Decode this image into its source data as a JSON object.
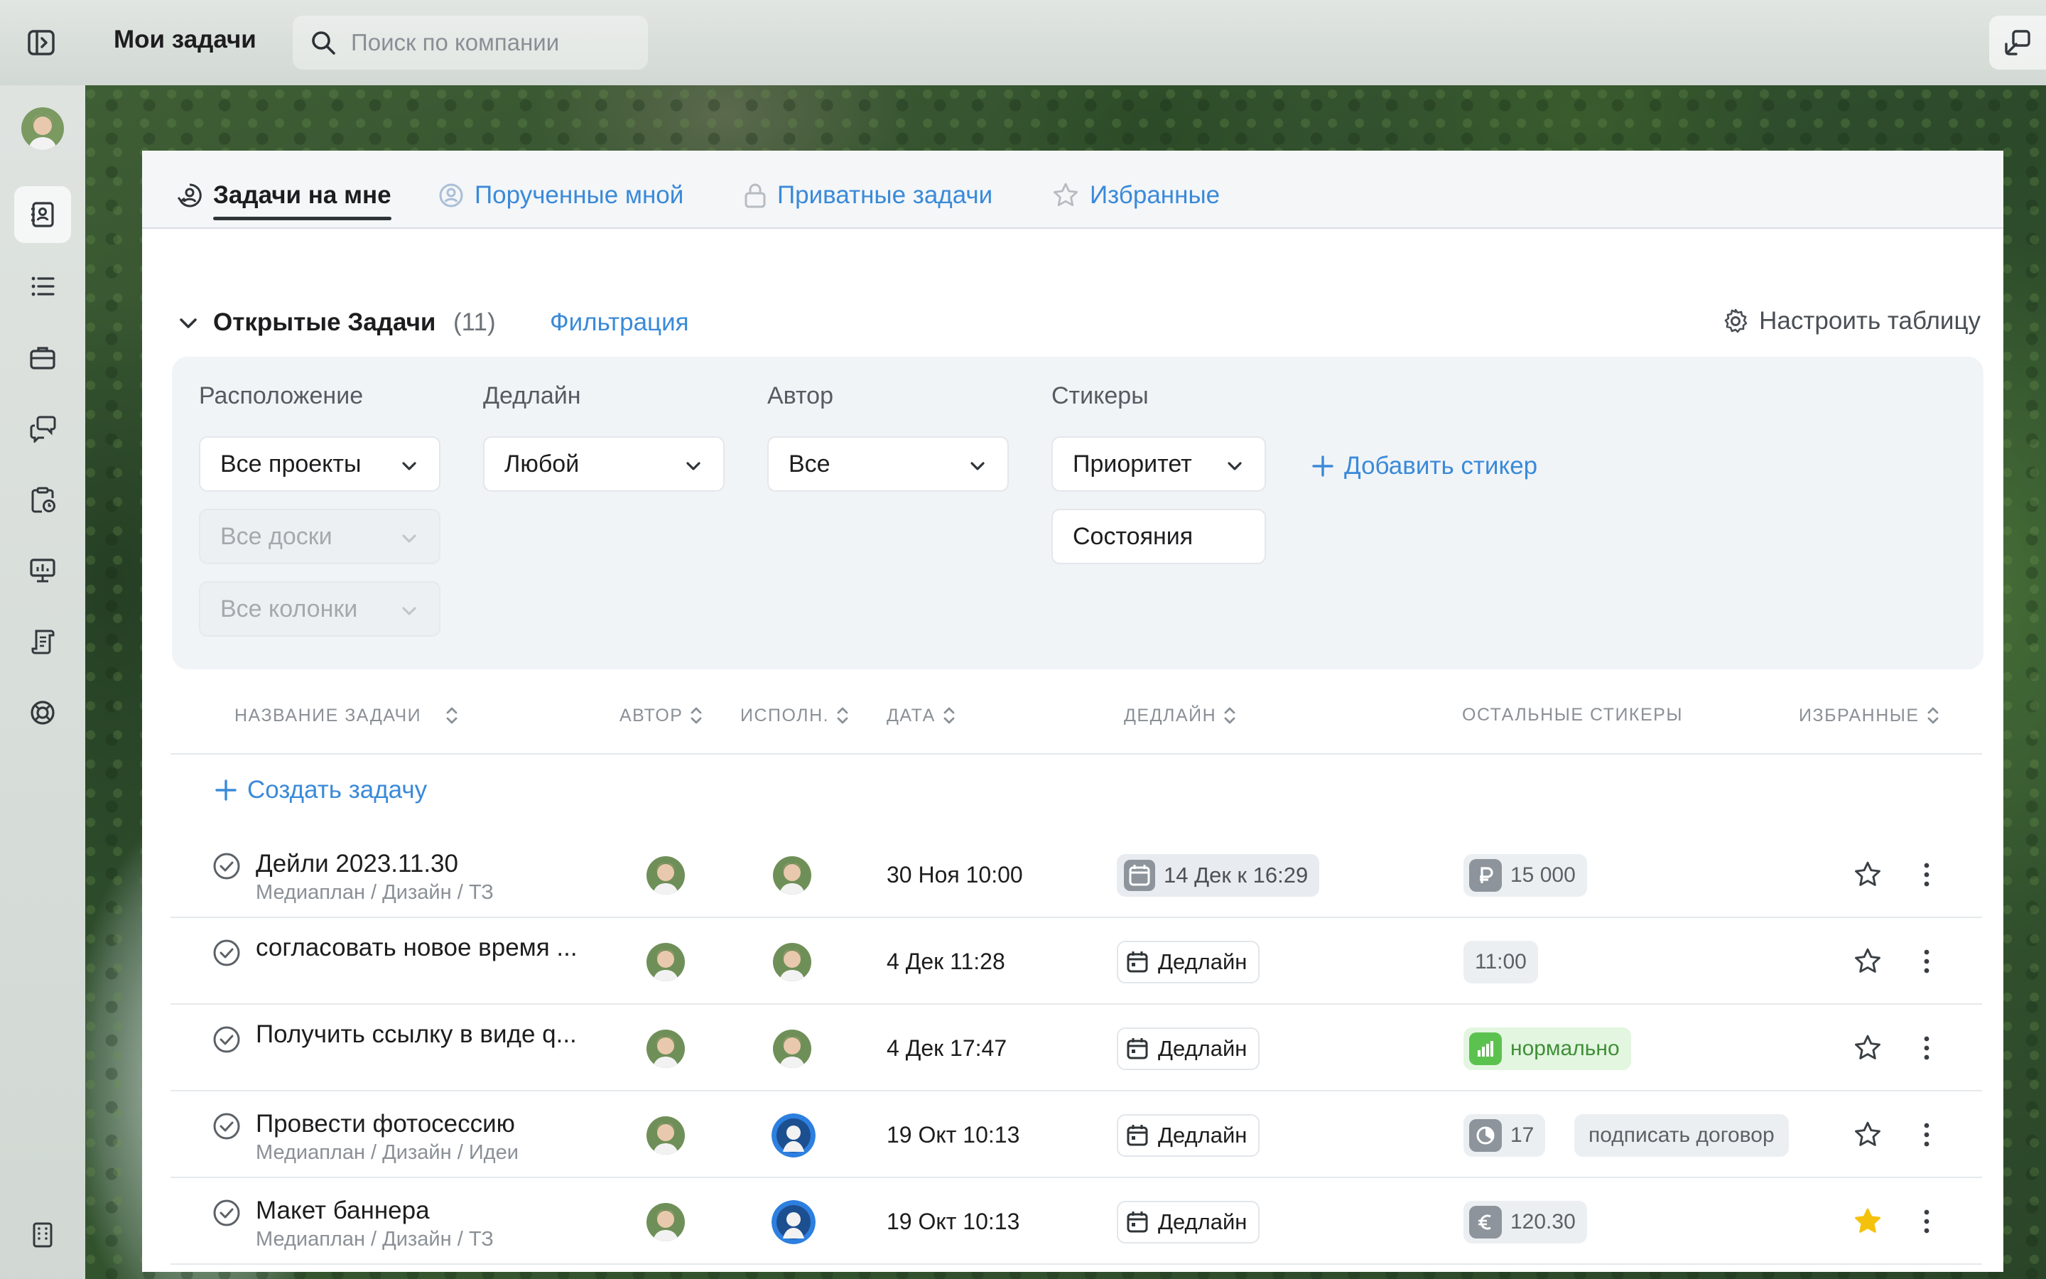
{
  "topbar": {
    "title": "Мои задачи",
    "search_placeholder": "Поиск по компании"
  },
  "tabs": [
    {
      "label": "Задачи на мне",
      "icon": "user-circle-icon",
      "active": true
    },
    {
      "label": "Порученные мной",
      "icon": "user-arrow-icon",
      "active": false
    },
    {
      "label": "Приватные задачи",
      "icon": "lock-icon",
      "active": false
    },
    {
      "label": "Избранные",
      "icon": "star-icon",
      "active": false
    }
  ],
  "section": {
    "title": "Открытые Задачи",
    "count": "(11)",
    "filter_label": "Фильтрация",
    "configure_label": "Настроить таблицу"
  },
  "filters": {
    "location_label": "Расположение",
    "location_projects": "Все проекты",
    "location_boards": "Все доски",
    "location_columns": "Все колонки",
    "deadline_label": "Дедлайн",
    "deadline_value": "Любой",
    "author_label": "Автор",
    "author_value": "Все",
    "stickers_label": "Стикеры",
    "sticker_priority": "Приоритет",
    "sticker_states": "Состояния",
    "add_sticker": "Добавить стикер"
  },
  "table": {
    "headers": {
      "name": "НАЗВАНИЕ ЗАДАЧИ",
      "author": "АВТОР",
      "assignee": "ИСПОЛН.",
      "date": "ДАТА",
      "deadline": "ДЕДЛАЙН",
      "stickers": "ОСТАЛЬНЫЕ СТИКЕРЫ",
      "favorites": "ИЗБРАННЫЕ"
    },
    "create_label": "Создать задачу",
    "rows": [
      {
        "title": "Дейли 2023.11.30",
        "path": "Медиаплан / Дизайн / ТЗ",
        "date": "30 Ноя 10:00",
        "deadline": "14 Дек к 16:29",
        "sticker1": "15 000",
        "sticker2": "",
        "favorite": false
      },
      {
        "title": "согласовать новое время ...",
        "path": "",
        "date": "4 Дек 11:28",
        "deadline": "Дедлайн",
        "sticker1": "11:00",
        "sticker2": "",
        "favorite": false
      },
      {
        "title": "Получить ссылку в виде q...",
        "path": "",
        "date": "4 Дек 17:47",
        "deadline": "Дедлайн",
        "sticker1": "нормально",
        "sticker2": "",
        "favorite": false
      },
      {
        "title": "Провести фотосессию",
        "path": "Медиаплан / Дизайн / Идеи",
        "date": "19 Окт 10:13",
        "deadline": "Дедлайн",
        "sticker1": "17",
        "sticker2": "подписать договор",
        "favorite": false
      },
      {
        "title": "Макет баннера",
        "path": "Медиаплан / Дизайн / ТЗ",
        "date": "19 Окт 10:13",
        "deadline": "Дедлайн",
        "sticker1": "120.30",
        "sticker2": "",
        "favorite": true
      }
    ]
  },
  "colors": {
    "accent": "#3a8ad8",
    "favorite": "#f4c20d",
    "status_green": "#5cc24f"
  }
}
